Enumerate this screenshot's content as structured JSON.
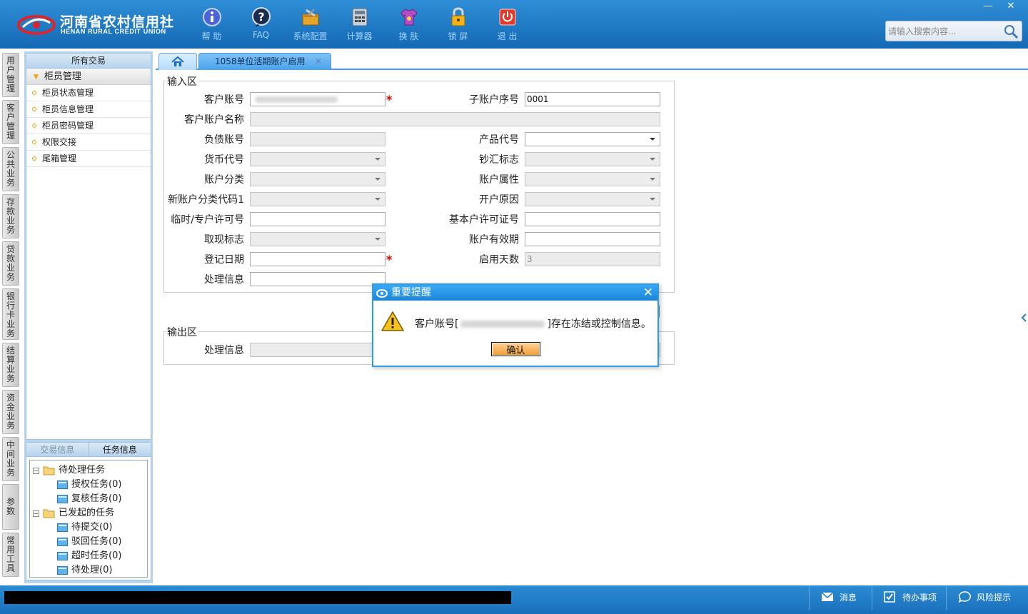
{
  "app": {
    "logo_cn": "河南省农村信用社",
    "logo_en": "HENAN RURAL CREDIT UNION"
  },
  "toolbar": [
    {
      "label": "帮 助",
      "icon": "help-icon"
    },
    {
      "label": "FAQ",
      "icon": "faq-icon"
    },
    {
      "label": "系统配置",
      "icon": "toolbox-icon"
    },
    {
      "label": "计算器",
      "icon": "calculator-icon"
    },
    {
      "label": "换 肤",
      "icon": "shirt-icon"
    },
    {
      "label": "锁 屏",
      "icon": "lock-icon"
    },
    {
      "label": "退 出",
      "icon": "power-icon"
    }
  ],
  "window": {
    "minimize": "—",
    "close": "✕"
  },
  "search": {
    "placeholder": "请输入搜索内容..."
  },
  "vtabs": [
    "用户管理",
    "客户管理",
    "公共业务",
    "存款业务",
    "贷款业务",
    "银行卡业务",
    "结算业务",
    "资金业务",
    "中间业务",
    "参数",
    "常用工具"
  ],
  "sidebar": {
    "header": "所有交易",
    "group": "柜员管理",
    "items": [
      "柜员状态管理",
      "柜员信息管理",
      "柜员密码管理",
      "权限交接",
      "尾箱管理"
    ]
  },
  "tasks": {
    "tabs": [
      "交易信息",
      "任务信息"
    ],
    "tree": [
      {
        "label": "待处理任务",
        "level": 0
      },
      {
        "label": "授权任务(0)",
        "level": 1
      },
      {
        "label": "复核任务(0)",
        "level": 1
      },
      {
        "label": "已发起的任务",
        "level": 0
      },
      {
        "label": "待提交(0)",
        "level": 1
      },
      {
        "label": "驳回任务(0)",
        "level": 1
      },
      {
        "label": "超时任务(0)",
        "level": 1
      },
      {
        "label": "待处理(0)",
        "level": 1
      }
    ]
  },
  "tabs": {
    "page": "1058单位活期账户启用",
    "close": "✕"
  },
  "form": {
    "input_legend": "输入区",
    "output_legend": "输出区",
    "labels": {
      "customer_account": "客户账号",
      "sub_account_seq": "子账户序号",
      "customer_account_name": "客户账户名称",
      "liability_account": "负债账号",
      "product_code": "产品代号",
      "currency_code": "货币代号",
      "cash_remit_flag": "钞汇标志",
      "account_class": "账户分类",
      "account_attr": "账户属性",
      "new_class_code": "新账户分类代码1",
      "open_reason": "开户原因",
      "temp_license": "临时/专户许可号",
      "basic_license": "基本户许可证号",
      "withdraw_flag": "取现标志",
      "account_valid": "账户有效期",
      "register_date": "登记日期",
      "enable_days": "启用天数",
      "process_info": "处理信息",
      "out_process_info": "处理信息"
    },
    "values": {
      "sub_account_seq": "0001",
      "enable_days": "3"
    },
    "required_mark": "*"
  },
  "dialog": {
    "title": "重要提醒",
    "close": "✕",
    "msg_prefix": "客户账号[",
    "msg_suffix": "]存在冻结或控制信息。",
    "ok": "确认"
  },
  "status": {
    "messages": "消息",
    "todo": "待办事项",
    "risk": "风险提示"
  },
  "colors": {
    "header": "#1f7cc8",
    "tab_active": "#4aa3ea",
    "required": "#e00000",
    "ok_button": "#f39a32",
    "statusbar": "#2180c9"
  }
}
